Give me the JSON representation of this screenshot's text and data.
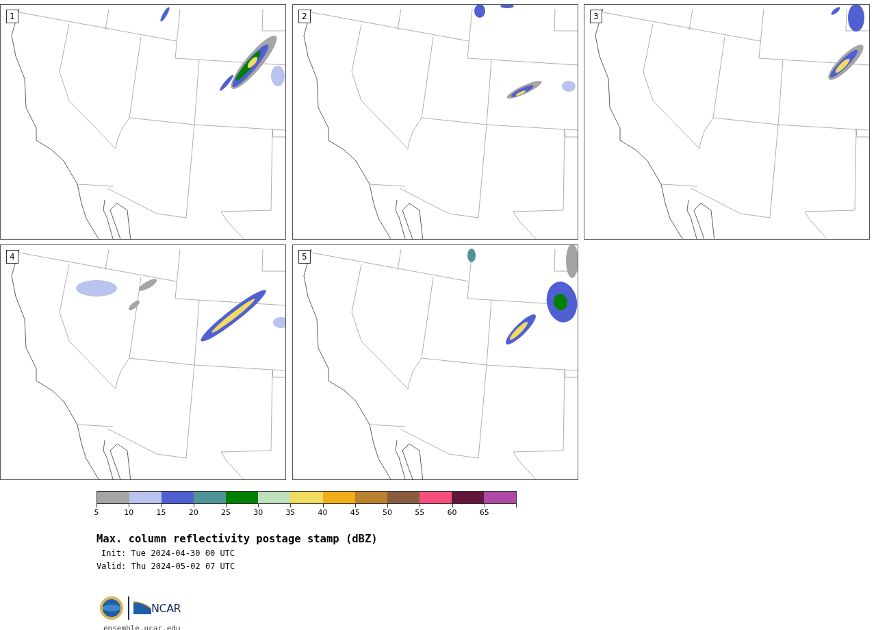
{
  "panels": [
    {
      "label": "1"
    },
    {
      "label": "2"
    },
    {
      "label": "3"
    },
    {
      "label": "4"
    },
    {
      "label": "5"
    }
  ],
  "colorbar": {
    "segments": [
      {
        "color": "#a5a5a5"
      },
      {
        "color": "#b9c3ed"
      },
      {
        "color": "#5060d3"
      },
      {
        "color": "#4f9598"
      },
      {
        "color": "#008000"
      },
      {
        "color": "#c0dfbd"
      },
      {
        "color": "#f0dc60"
      },
      {
        "color": "#f0ae18"
      },
      {
        "color": "#b9822f"
      },
      {
        "color": "#8a5b3f"
      },
      {
        "color": "#f5507d"
      },
      {
        "color": "#62173a"
      },
      {
        "color": "#ae4aa5"
      }
    ],
    "ticks": [
      "5",
      "10",
      "15",
      "20",
      "25",
      "30",
      "35",
      "40",
      "45",
      "50",
      "55",
      "60",
      "65"
    ]
  },
  "title": "Max. column reflectivity postage stamp (dBZ)",
  "init": "Init: Tue 2024-04-30 00 UTC",
  "valid": "Valid: Thu 2024-05-02 07 UTC",
  "logo": {
    "wordmark": "NCAR"
  },
  "url": "ensemble.ucar.edu"
}
